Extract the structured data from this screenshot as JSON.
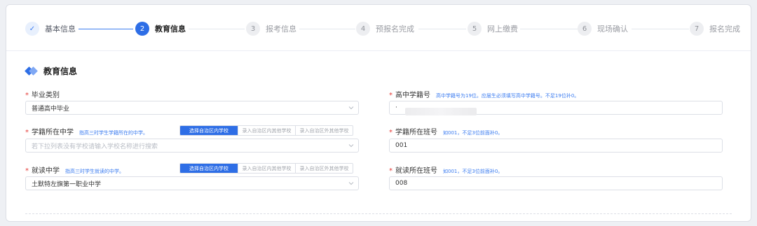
{
  "steps": [
    {
      "num": "✓",
      "label": "基本信息",
      "state": "done"
    },
    {
      "num": "2",
      "label": "教育信息",
      "state": "active"
    },
    {
      "num": "3",
      "label": "报考信息",
      "state": "todo"
    },
    {
      "num": "4",
      "label": "预报名完成",
      "state": "todo"
    },
    {
      "num": "5",
      "label": "网上缴费",
      "state": "todo"
    },
    {
      "num": "6",
      "label": "现场确认",
      "state": "todo"
    },
    {
      "num": "7",
      "label": "报名完成",
      "state": "todo"
    }
  ],
  "section": {
    "title": "教育信息"
  },
  "form": {
    "grad_type": {
      "label": "毕业类别",
      "value": "普通高中毕业"
    },
    "school": {
      "label": "学籍所在中学",
      "hint": "指高三时学生学籍所在的中学。",
      "placeholder": "若下拉列表没有学校请输入学校名称进行搜索",
      "options": [
        "选择自治区内学校",
        "录入自治区内其他学校",
        "录入自治区外其他学校"
      ],
      "selected": "选择自治区内学校"
    },
    "study_school": {
      "label": "就读中学",
      "hint": "指高三时学生就读的中学。",
      "value": "土默特左旗第一职业中学",
      "options": [
        "选择自治区内学校",
        "录入自治区内其他学校",
        "录入自治区外其他学校"
      ],
      "selected": "选择自治区内学校"
    },
    "student_no": {
      "label": "高中学籍号",
      "hint": "高中学籍号为19位。应届生必须填写高中学籍号。不足19位补0。",
      "value": "·"
    },
    "class_no": {
      "label": "学籍所在班号",
      "hint": "如001，不足3位前面补0。",
      "value": "001"
    },
    "study_class_no": {
      "label": "就读所在班号",
      "hint": "如001，不足3位前面补0。",
      "value": "008"
    }
  },
  "colors": {
    "accent": "#2e6ee6",
    "required": "#e53935",
    "hint": "#3a7bf0"
  }
}
